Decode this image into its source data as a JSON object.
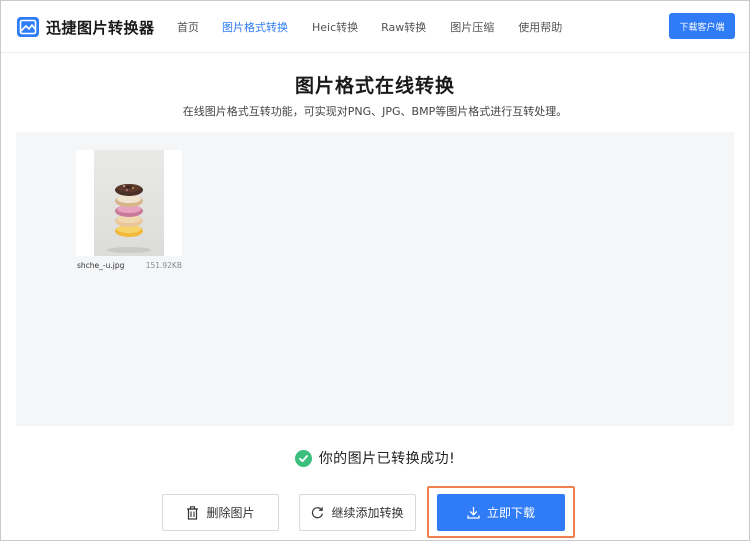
{
  "app": {
    "name": "迅捷图片转换器"
  },
  "nav": {
    "items": [
      {
        "label": "首页",
        "active": false
      },
      {
        "label": "图片格式转换",
        "active": true
      },
      {
        "label": "Heic转换",
        "active": false
      },
      {
        "label": "Raw转换",
        "active": false
      },
      {
        "label": "图片压缩",
        "active": false
      },
      {
        "label": "使用帮助",
        "active": false
      }
    ],
    "download_client": "下载客户端"
  },
  "main": {
    "title": "图片格式在线转换",
    "subtitle": "在线图片格式互转功能，可实现对PNG、JPG、BMP等图片格式进行互转处理。"
  },
  "files": [
    {
      "name": "shche_-u.jpg",
      "size": "151.92KB"
    }
  ],
  "status": {
    "message": "你的图片已转换成功!"
  },
  "actions": {
    "delete_label": "删除图片",
    "continue_label": "继续添加转换",
    "download_label": "立即下载"
  },
  "colors": {
    "accent": "#2f7cf6",
    "success": "#3bbf7c",
    "highlight_outline": "#f08050",
    "preview_bg": "#f5f6f8"
  },
  "icons": {
    "logo": "image-logo-icon",
    "check": "check-circle-icon",
    "delete": "trash-icon",
    "continue": "refresh-icon",
    "download": "download-icon"
  }
}
